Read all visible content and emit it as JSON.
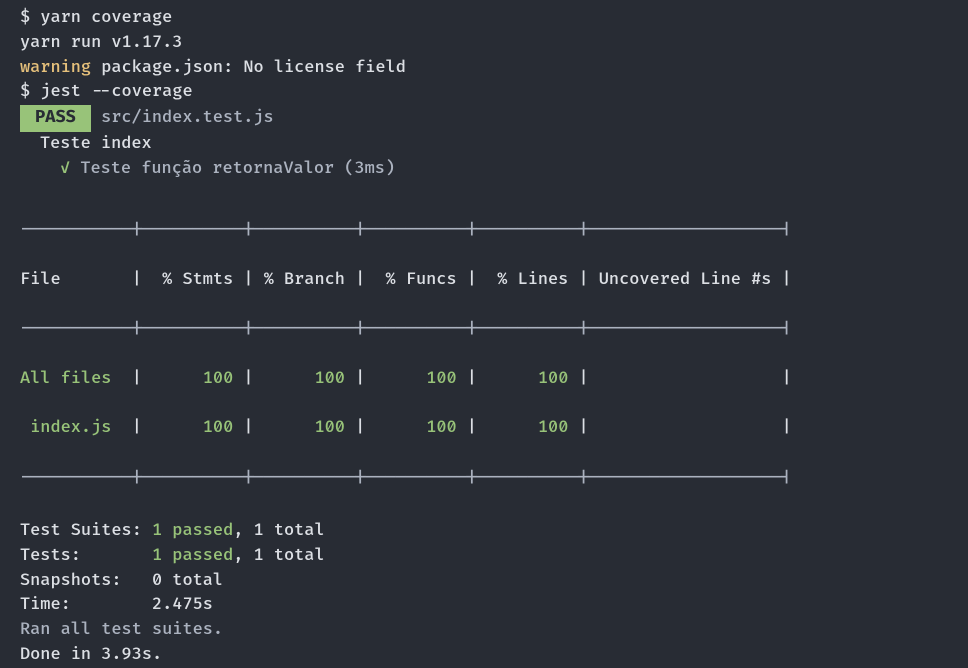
{
  "prompt1": "$ ",
  "cmd1": "yarn coverage",
  "yarn_run": "yarn run v1.17.3",
  "warning_label": "warning",
  "warning_text": " package.json: No license field",
  "prompt2": "$ ",
  "cmd2": "jest --coverage",
  "pass_badge": " PASS ",
  "test_file": " src/index.test.js",
  "suite_name": "Teste index",
  "check": "✓ ",
  "test_name": "Teste função retornaValor (3ms)",
  "table": {
    "divider": "-----------|----------|----------|----------|----------|-------------------|",
    "header": "File       |  % Stmts | % Branch |  % Funcs |  % Lines | Uncovered Line #s |",
    "row_all_a": "All files",
    "row_all_b": "  |      ",
    "row_all_c": "100",
    "row_all_d": " |      ",
    "row_all_e": "100",
    "row_all_f": " |      ",
    "row_all_g": "100",
    "row_all_h": " |      ",
    "row_all_i": "100",
    "row_all_j": " |                   |",
    "row_idx_a": " index.js",
    "row_idx_b": "  |      ",
    "row_idx_c": "100",
    "row_idx_d": " |      ",
    "row_idx_e": "100",
    "row_idx_f": " |      ",
    "row_idx_g": "100",
    "row_idx_h": " |      ",
    "row_idx_i": "100",
    "row_idx_j": " |                   |"
  },
  "summary": {
    "suites_label": "Test Suites: ",
    "suites_green": "1 passed",
    "suites_rest": ", 1 total",
    "tests_label": "Tests:       ",
    "tests_green": "1 passed",
    "tests_rest": ", 1 total",
    "snapshots_label": "Snapshots:   ",
    "snapshots_value": "0 total",
    "time_label": "Time:        ",
    "time_value": "2.475s",
    "ran": "Ran all test suites.",
    "done": "Done in 3.93s."
  },
  "chart_data": {
    "type": "table",
    "title": "Jest Coverage Report",
    "columns": [
      "File",
      "% Stmts",
      "% Branch",
      "% Funcs",
      "% Lines",
      "Uncovered Line #s"
    ],
    "rows": [
      {
        "File": "All files",
        "% Stmts": 100,
        "% Branch": 100,
        "% Funcs": 100,
        "% Lines": 100,
        "Uncovered Line #s": ""
      },
      {
        "File": "index.js",
        "% Stmts": 100,
        "% Branch": 100,
        "% Funcs": 100,
        "% Lines": 100,
        "Uncovered Line #s": ""
      }
    ]
  }
}
